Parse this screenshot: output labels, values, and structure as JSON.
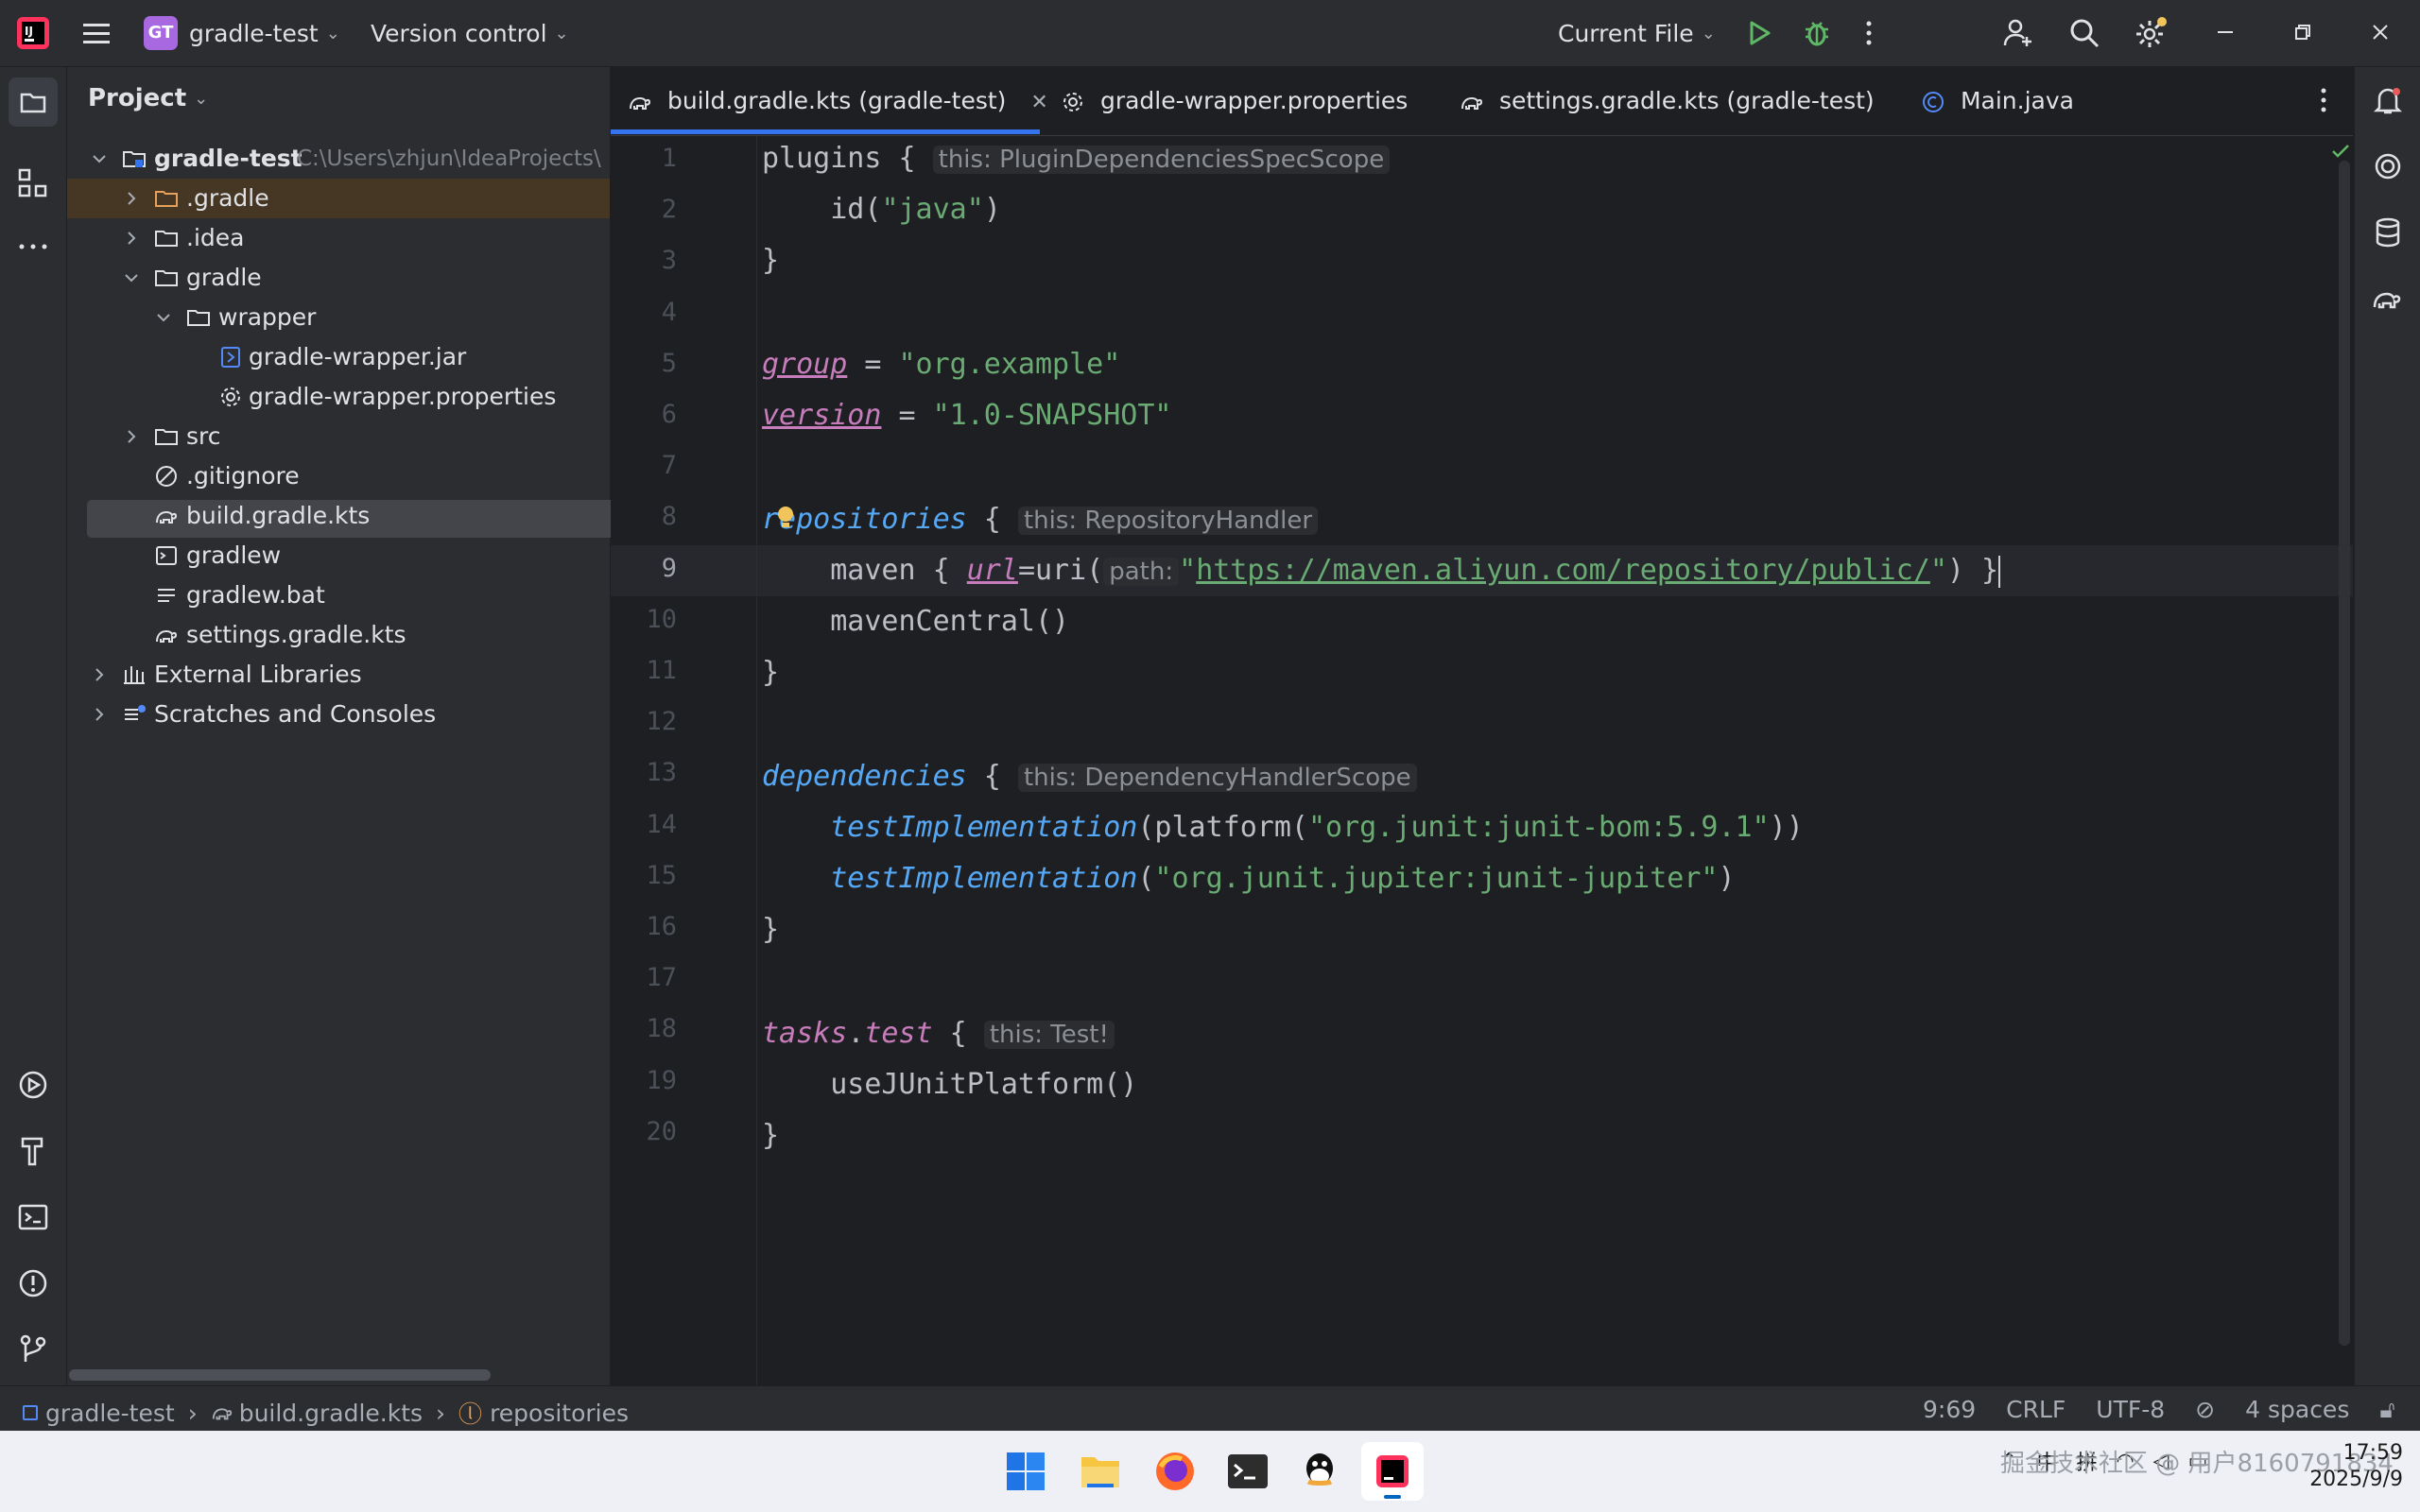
{
  "titlebar": {
    "project_badge": "GT",
    "project_name": "gradle-test",
    "version_control": "Version control",
    "run_config": "Current File"
  },
  "project_panel": {
    "title": "Project",
    "root_name": "gradle-test",
    "root_path": "C:\\Users\\zhjun\\IdeaProjects\\",
    "items": [
      {
        "label": ".gradle"
      },
      {
        "label": ".idea"
      },
      {
        "label": "gradle"
      },
      {
        "label": "wrapper"
      },
      {
        "label": "gradle-wrapper.jar"
      },
      {
        "label": "gradle-wrapper.properties"
      },
      {
        "label": "src"
      },
      {
        "label": ".gitignore"
      },
      {
        "label": "build.gradle.kts"
      },
      {
        "label": "gradlew"
      },
      {
        "label": "gradlew.bat"
      },
      {
        "label": "settings.gradle.kts"
      },
      {
        "label": "External Libraries"
      },
      {
        "label": "Scratches and Consoles"
      }
    ]
  },
  "tabs": [
    {
      "label": "build.gradle.kts (gradle-test)"
    },
    {
      "label": "gradle-wrapper.properties"
    },
    {
      "label": "settings.gradle.kts (gradle-test)"
    },
    {
      "label": "Main.java"
    }
  ],
  "editor": {
    "line_numbers": [
      "1",
      "2",
      "3",
      "4",
      "5",
      "6",
      "7",
      "8",
      "9",
      "10",
      "11",
      "12",
      "13",
      "14",
      "15",
      "16",
      "17",
      "18",
      "19",
      "20"
    ],
    "code": {
      "l1_a": "plugins {",
      "l1_hint": "this: PluginDependenciesSpecScope",
      "l2_a": "    id(",
      "l2_s": "\"java\"",
      "l2_b": ")",
      "brace": "}",
      "l5_p": "group",
      "l5_eq": " = ",
      "l5_s": "\"org.example\"",
      "l6_p": "version",
      "l6_s": "\"1.0-SNAPSHOT\"",
      "l8_f": "repositories",
      "l8_b": " {",
      "l8_hint": "this: RepositoryHandler",
      "l9_a": "    maven { ",
      "l9_p": "url",
      "l9_b": "=uri(",
      "l9_hint": "path:",
      "l9_s1": "\"",
      "l9_url": "https://maven.aliyun.com/repository/public/",
      "l9_s2": "\"",
      "l9_c": ") }",
      "l10": "    mavenCentral()",
      "l13_f": "dependencies",
      "l13_hint": "this: DependencyHandlerScope",
      "l14_f": "testImplementation",
      "l14_a": "(platform(",
      "l14_s": "\"org.junit:junit-bom:5.9.1\"",
      "l14_b": "))",
      "l15_f": "testImplementation",
      "l15_a": "(",
      "l15_s": "\"org.junit.jupiter:junit-jupiter\"",
      "l15_b": ")",
      "l18_t": "tasks",
      "l18_d": ".",
      "l18_f": "test",
      "l18_hint": "this: Test!",
      "l19": "    useJUnitPlatform()"
    }
  },
  "statusbar": {
    "crumb_project": "gradle-test",
    "crumb_file": "build.gradle.kts",
    "crumb_symbol": "repositories",
    "position": "9:69",
    "line_sep": "CRLF",
    "encoding": "UTF-8",
    "indent": "4 spaces"
  },
  "taskbar": {
    "tray_ime": "中",
    "tray_ime2": "拼",
    "watermark": "掘金技术社区 @ 用户8160791834",
    "time": "17:59",
    "date": "2025/9/9"
  },
  "colors": {
    "accent": "#3574f0",
    "badge": "#a869e0",
    "run": "#5fb865"
  }
}
